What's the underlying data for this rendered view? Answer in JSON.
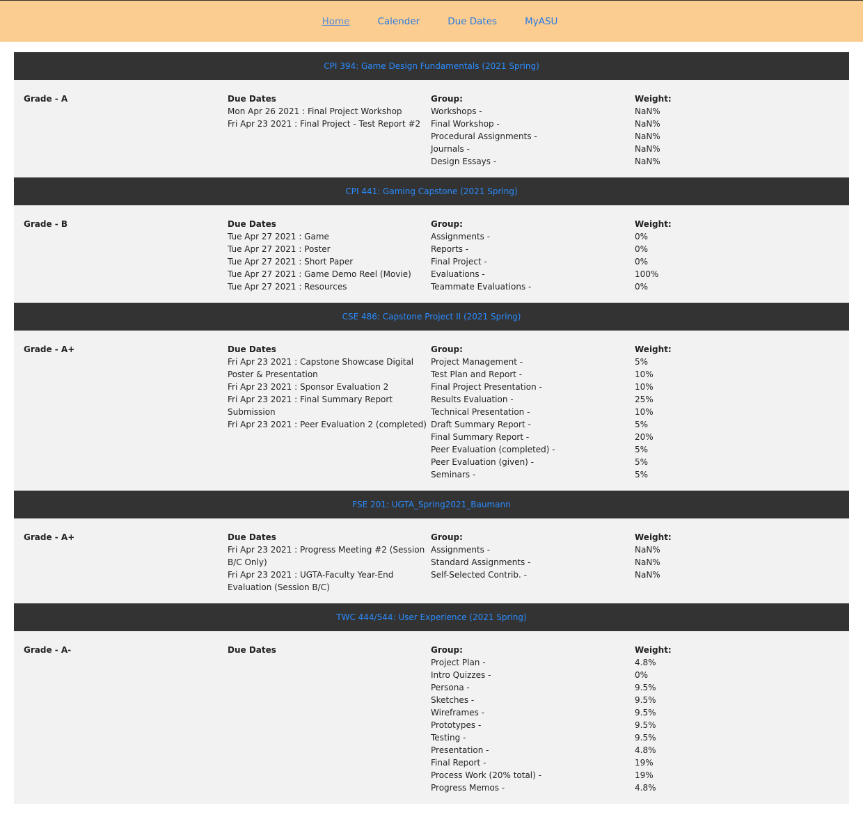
{
  "nav": {
    "items": [
      {
        "label": "Home"
      },
      {
        "label": "Calender"
      },
      {
        "label": "Due Dates"
      },
      {
        "label": "MyASU"
      }
    ]
  },
  "labels": {
    "due_dates": "Due Dates",
    "group": "Group:",
    "weight": "Weight:"
  },
  "courses": [
    {
      "title": "CPI 394: Game Design Fundamentals (2021 Spring)",
      "grade": "Grade - A",
      "due_dates": [
        "Mon Apr 26 2021 : Final Project Workshop",
        "Fri Apr 23 2021 : Final Project - Test Report #2"
      ],
      "groups": [
        {
          "name": "Workshops -",
          "weight": "NaN%"
        },
        {
          "name": "Final Workshop -",
          "weight": "NaN%"
        },
        {
          "name": "Procedural Assignments -",
          "weight": "NaN%"
        },
        {
          "name": "Journals -",
          "weight": "NaN%"
        },
        {
          "name": "Design Essays -",
          "weight": "NaN%"
        }
      ]
    },
    {
      "title": "CPI 441: Gaming Capstone (2021 Spring)",
      "grade": "Grade - B",
      "due_dates": [
        "Tue Apr 27 2021 : Game",
        "Tue Apr 27 2021 : Poster",
        "Tue Apr 27 2021 : Short Paper",
        "Tue Apr 27 2021 : Game Demo Reel (Movie)",
        "Tue Apr 27 2021 : Resources"
      ],
      "groups": [
        {
          "name": "Assignments -",
          "weight": "0%"
        },
        {
          "name": "Reports -",
          "weight": "0%"
        },
        {
          "name": "Final Project -",
          "weight": "0%"
        },
        {
          "name": "Evaluations -",
          "weight": "100%"
        },
        {
          "name": "Teammate Evaluations -",
          "weight": "0%"
        }
      ]
    },
    {
      "title": "CSE 486: Capstone Project II (2021 Spring)",
      "grade": "Grade - A+",
      "due_dates": [
        "Fri Apr 23 2021 : Capstone Showcase Digital Poster & Presentation",
        "Fri Apr 23 2021 : Sponsor Evaluation 2",
        "Fri Apr 23 2021 : Final Summary Report Submission",
        "Fri Apr 23 2021 : Peer Evaluation 2 (completed)"
      ],
      "groups": [
        {
          "name": "Project Management -",
          "weight": "5%"
        },
        {
          "name": "Test Plan and Report -",
          "weight": "10%"
        },
        {
          "name": "Final Project Presentation -",
          "weight": "10%"
        },
        {
          "name": "Results Evaluation -",
          "weight": "25%"
        },
        {
          "name": "Technical Presentation -",
          "weight": "10%"
        },
        {
          "name": "Draft Summary Report -",
          "weight": "5%"
        },
        {
          "name": "Final Summary Report -",
          "weight": "20%"
        },
        {
          "name": "Peer Evaluation (completed) -",
          "weight": "5%"
        },
        {
          "name": "Peer Evaluation (given) -",
          "weight": "5%"
        },
        {
          "name": "Seminars -",
          "weight": "5%"
        }
      ]
    },
    {
      "title": "FSE 201: UGTA_Spring2021_Baumann",
      "grade": "Grade - A+",
      "due_dates": [
        "Fri Apr 23 2021 : Progress Meeting #2 (Session B/C Only)",
        "Fri Apr 23 2021 : UGTA-Faculty Year-End Evaluation (Session B/C)"
      ],
      "groups": [
        {
          "name": "Assignments -",
          "weight": "NaN%"
        },
        {
          "name": "Standard Assignments -",
          "weight": "NaN%"
        },
        {
          "name": "Self-Selected Contrib. -",
          "weight": "NaN%"
        }
      ]
    },
    {
      "title": "TWC 444/544: User Experience (2021 Spring)",
      "grade": "Grade - A-",
      "due_dates": [],
      "groups": [
        {
          "name": "Project Plan -",
          "weight": "4.8%"
        },
        {
          "name": "Intro Quizzes -",
          "weight": "0%"
        },
        {
          "name": "Persona -",
          "weight": "9.5%"
        },
        {
          "name": "Sketches -",
          "weight": "9.5%"
        },
        {
          "name": "Wireframes -",
          "weight": "9.5%"
        },
        {
          "name": "Prototypes -",
          "weight": "9.5%"
        },
        {
          "name": "Testing -",
          "weight": "9.5%"
        },
        {
          "name": "Presentation -",
          "weight": "4.8%"
        },
        {
          "name": "Final Report -",
          "weight": "19%"
        },
        {
          "name": "Process Work (20% total) -",
          "weight": "19%"
        },
        {
          "name": "Progress Memos -",
          "weight": "4.8%"
        }
      ]
    }
  ]
}
